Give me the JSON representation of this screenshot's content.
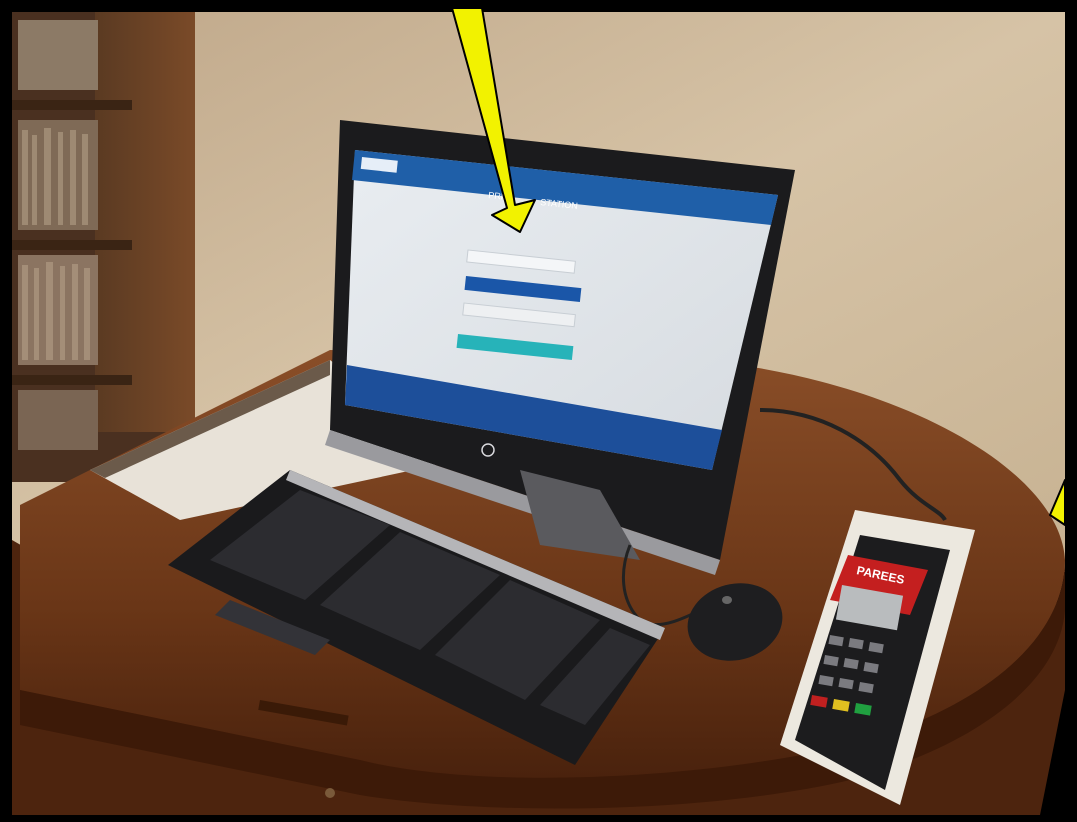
{
  "kiosk_screen": {
    "title_left": "PRI",
    "title_right": "STATION",
    "colors": {
      "header": "#1f5fa8",
      "primary_button": "#1a56a8",
      "secondary_button": "#27b3b9",
      "footer": "#1d4f9a",
      "arrow": "#f2f200"
    }
  },
  "card_reader": {
    "label": "PAREES"
  },
  "icons": [
    "arrow-icon",
    "hp-logo-icon"
  ]
}
